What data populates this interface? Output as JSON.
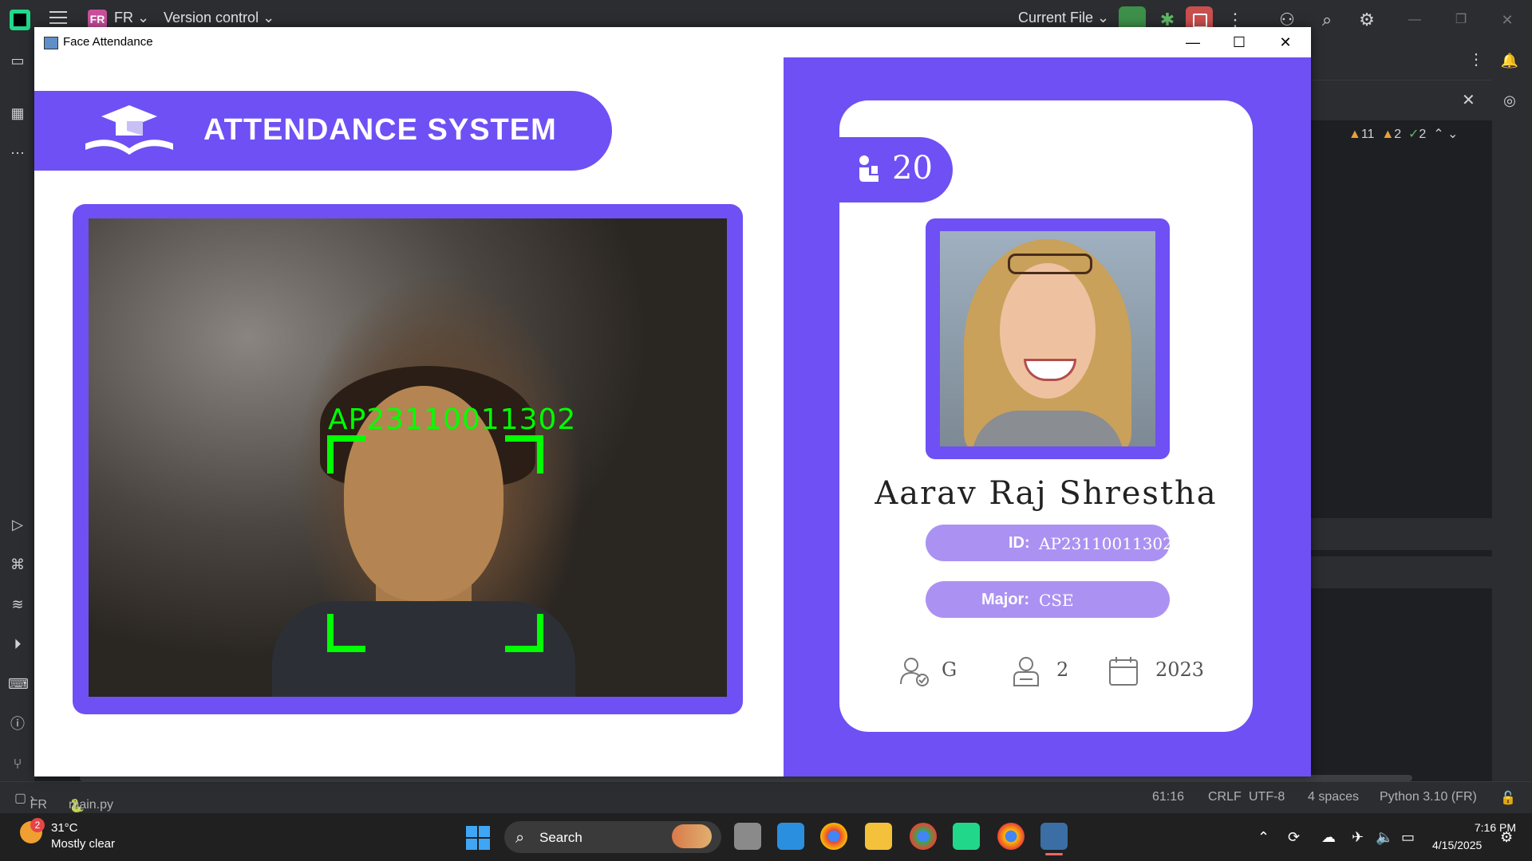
{
  "ide": {
    "project_badge": "FR",
    "project_name": "FR",
    "vcs_label": "Version control",
    "run_config": "Current File",
    "inspections": {
      "warnings": "11",
      "weak_warnings": "2",
      "ok": "2"
    },
    "status": {
      "breadcrumb_project": "FR",
      "breadcrumb_file": "main.py",
      "position": "61:16",
      "line_sep": "CRLF",
      "encoding": "UTF-8",
      "indent": "4 spaces",
      "interpreter": "Python 3.10 (FR)"
    }
  },
  "window": {
    "title": "Face Attendance"
  },
  "app": {
    "header_title": "ATTENDANCE SYSTEM",
    "camera": {
      "recognized_label": "AP23110011302",
      "box_color": "#00ff00"
    },
    "student": {
      "attendance_count": "20",
      "name": "Aarav Raj Shrestha",
      "id_label": "ID:",
      "id_value": "AP23110011302",
      "major_label": "Major:",
      "major_value": "CSE",
      "standing": "G",
      "year": "2",
      "starting_year": "2023"
    },
    "colors": {
      "accent": "#6f50f4",
      "pill": "#ab92f2"
    }
  },
  "taskbar": {
    "weather_badge": "2",
    "temperature": "31°C",
    "condition": "Mostly clear",
    "search_label": "Search",
    "time": "7:16 PM",
    "date": "4/15/2025"
  }
}
